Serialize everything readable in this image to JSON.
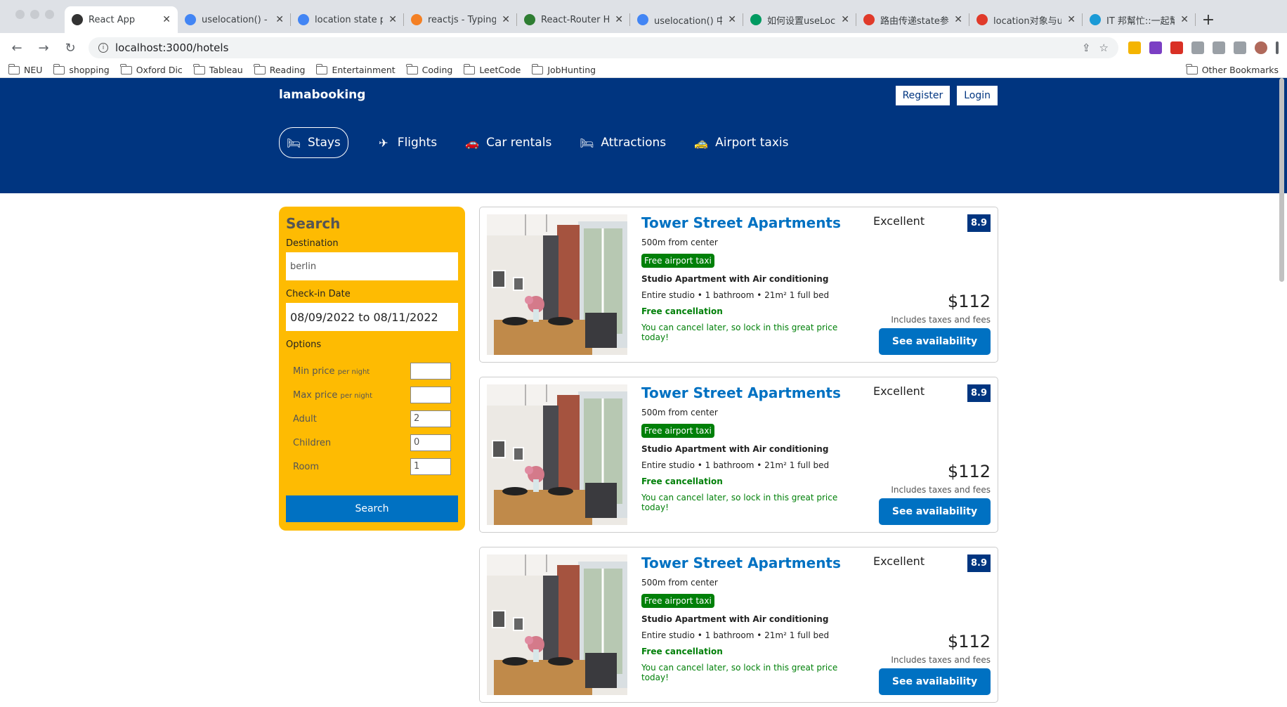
{
  "browser": {
    "tabs": [
      {
        "title": "React App",
        "fav_color": "#333"
      },
      {
        "title": "uselocation() - G",
        "fav_color": "#4285f4"
      },
      {
        "title": "location state pro",
        "fav_color": "#4285f4"
      },
      {
        "title": "reactjs - Typing t",
        "fav_color": "#f48024"
      },
      {
        "title": "React-Router Ho",
        "fav_color": "#2e7d32"
      },
      {
        "title": "uselocation() 中",
        "fav_color": "#4285f4"
      },
      {
        "title": "如何设置useLoca",
        "fav_color": "#009a61"
      },
      {
        "title": "路由传递state参",
        "fav_color": "#e03a2a"
      },
      {
        "title": "location对象与us",
        "fav_color": "#e03a2a"
      },
      {
        "title": "IT 邦幫忙::一起幫",
        "fav_color": "#1a9ad6"
      }
    ],
    "url": "localhost:3000/hotels",
    "bookmarks": [
      "NEU",
      "shopping",
      "Oxford Dic",
      "Tableau",
      "Reading",
      "Entertainment",
      "Coding",
      "LeetCode",
      "JobHunting"
    ],
    "other_bookmarks": "Other Bookmarks"
  },
  "header": {
    "logo": "lamabooking",
    "register": "Register",
    "login": "Login",
    "nav": [
      {
        "label": "Stays",
        "icon": "bed-icon"
      },
      {
        "label": "Flights",
        "icon": "plane-icon"
      },
      {
        "label": "Car rentals",
        "icon": "car-icon"
      },
      {
        "label": "Attractions",
        "icon": "bed-icon"
      },
      {
        "label": "Airport taxis",
        "icon": "taxi-icon"
      }
    ]
  },
  "search": {
    "title": "Search",
    "destination_label": "Destination",
    "destination_value": "berlin",
    "checkin_label": "Check-in Date",
    "checkin_value": "08/09/2022 to 08/11/2022",
    "options_label": "Options",
    "options": [
      {
        "label": "Min price",
        "small": "per night",
        "value": ""
      },
      {
        "label": "Max price",
        "small": "per night",
        "value": ""
      },
      {
        "label": "Adult",
        "small": "",
        "value": "2"
      },
      {
        "label": "Children",
        "small": "",
        "value": "0"
      },
      {
        "label": "Room",
        "small": "",
        "value": "1"
      }
    ],
    "button": "Search"
  },
  "results": [
    {
      "name": "Tower Street Apartments",
      "distance": "500m from center",
      "taxi": "Free airport taxi",
      "subtitle": "Studio Apartment with Air conditioning",
      "features": "Entire studio • 1 bathroom • 21m² 1 full bed",
      "cancel": "Free cancellation",
      "cancel_sub": "You can cancel later, so lock in this great price today!",
      "rating_word": "Excellent",
      "rating": "8.9",
      "price": "$112",
      "tax": "Includes taxes and fees",
      "button": "See availability"
    },
    {
      "name": "Tower Street Apartments",
      "distance": "500m from center",
      "taxi": "Free airport taxi",
      "subtitle": "Studio Apartment with Air conditioning",
      "features": "Entire studio • 1 bathroom • 21m² 1 full bed",
      "cancel": "Free cancellation",
      "cancel_sub": "You can cancel later, so lock in this great price today!",
      "rating_word": "Excellent",
      "rating": "8.9",
      "price": "$112",
      "tax": "Includes taxes and fees",
      "button": "See availability"
    },
    {
      "name": "Tower Street Apartments",
      "distance": "500m from center",
      "taxi": "Free airport taxi",
      "subtitle": "Studio Apartment with Air conditioning",
      "features": "Entire studio • 1 bathroom • 21m² 1 full bed",
      "cancel": "Free cancellation",
      "cancel_sub": "You can cancel later, so lock in this great price today!",
      "rating_word": "Excellent",
      "rating": "8.9",
      "price": "$112",
      "tax": "Includes taxes and fees",
      "button": "See availability"
    }
  ],
  "colors": {
    "brand": "#003580",
    "search_panel": "#febb02",
    "link": "#0071c2",
    "green": "#008009"
  }
}
